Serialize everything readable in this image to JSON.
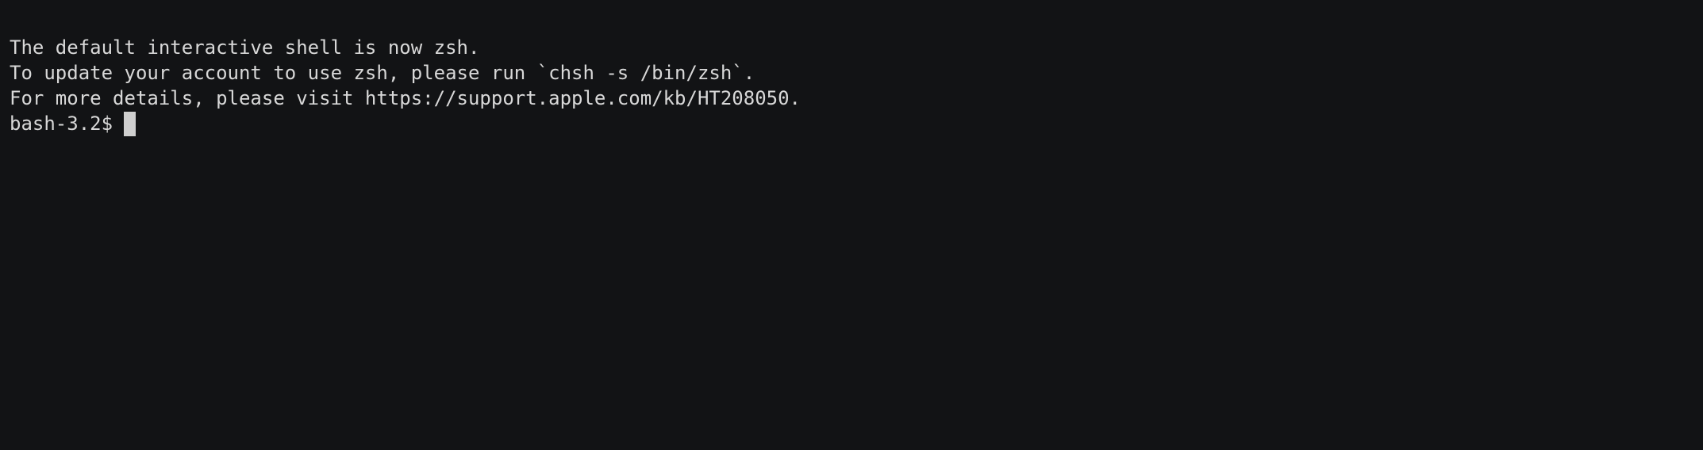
{
  "terminal": {
    "lines": [
      "The default interactive shell is now zsh.",
      "To update your account to use zsh, please run `chsh -s /bin/zsh`.",
      "For more details, please visit https://support.apple.com/kb/HT208050."
    ],
    "prompt": "bash-3.2$",
    "input": ""
  },
  "colors": {
    "background": "#121315",
    "text": "#d8d8d8",
    "cursor": "#cfcfcf"
  }
}
